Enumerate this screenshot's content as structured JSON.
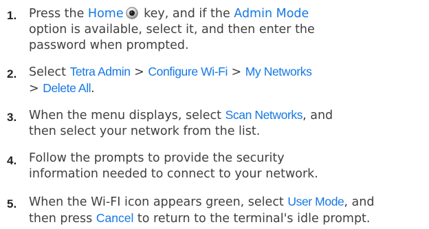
{
  "steps": [
    {
      "number": "1.",
      "line1_pre": "Press the ",
      "home_label": "Home",
      "line1_mid": " key, and if the ",
      "admin_mode_label": "Admin Mode",
      "line2": "option is available, select it, and then enter the",
      "line3": "password when prompted."
    },
    {
      "number": "2.",
      "line1_pre": "Select ",
      "tetra_admin": "Tetra Admin",
      "sep1": " > ",
      "configure_wifi": "Configure Wi-Fi",
      "sep2": " > ",
      "my_networks": "My Networks",
      "line2_pre": "> ",
      "delete_all": "Delete All",
      "line2_post": "."
    },
    {
      "number": "3.",
      "line1_pre": "When the menu displays, select ",
      "scan_networks": "Scan Networks",
      "line1_post": ", and",
      "line2": "then select your network from the list."
    },
    {
      "number": "4.",
      "line1": "Follow the prompts to provide the security",
      "line2": "information needed to connect to your network."
    },
    {
      "number": "5.",
      "line1_pre": "When the Wi-FI icon appears green, select ",
      "user_mode": "User Mode",
      "line1_post": ", and",
      "line2_pre": "then press ",
      "cancel": "Cancel",
      "line2_post": " to return to the terminal's idle prompt."
    }
  ],
  "colors": {
    "accent": "#1478e6",
    "text": "#3f3f3f",
    "number": "#222222"
  },
  "icons": {
    "home_key": "home-key-icon"
  }
}
